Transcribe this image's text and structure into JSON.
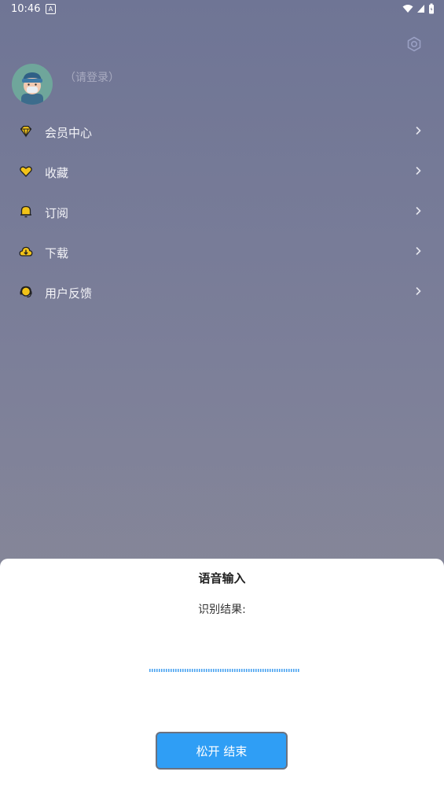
{
  "status_bar": {
    "time": "10:46",
    "notification": "A"
  },
  "profile": {
    "login_prompt": "（请登录）"
  },
  "menu": {
    "items": [
      {
        "label": "会员中心",
        "icon": "diamond-icon"
      },
      {
        "label": "收藏",
        "icon": "heart-icon"
      },
      {
        "label": "订阅",
        "icon": "bell-icon"
      },
      {
        "label": "下载",
        "icon": "cloud-download-icon"
      },
      {
        "label": "用户反馈",
        "icon": "headset-icon"
      }
    ]
  },
  "voice_dialog": {
    "title": "语音输入",
    "result_label": "识别结果:",
    "release_button": "松开 结束"
  },
  "colors": {
    "accent_yellow": "#f2c318",
    "button_blue": "#2f9ef5",
    "wave_blue": "#4aa3f0"
  }
}
